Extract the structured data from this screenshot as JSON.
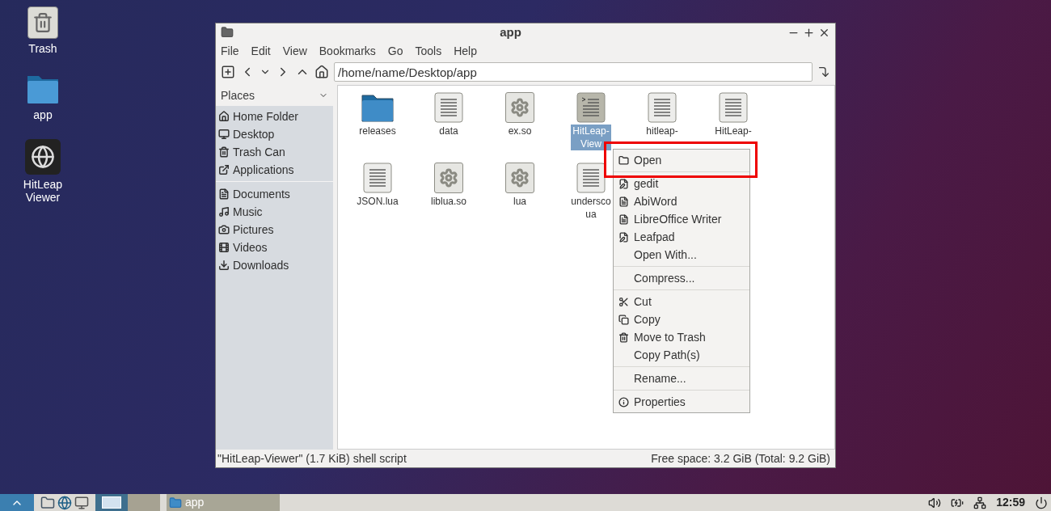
{
  "desktop_icons": [
    {
      "kind": "trash",
      "lines": [
        "Trash"
      ]
    },
    {
      "kind": "folder",
      "lines": [
        "app"
      ]
    },
    {
      "kind": "globe",
      "lines": [
        "HitLeap",
        "Viewer"
      ]
    }
  ],
  "window": {
    "title": "app",
    "menu": [
      "File",
      "Edit",
      "View",
      "Bookmarks",
      "Go",
      "Tools",
      "Help"
    ],
    "path": "/home/name/Desktop/app",
    "sidebar": {
      "header": "Places",
      "groups": [
        [
          "Home Folder",
          "Desktop",
          "Trash Can",
          "Applications"
        ],
        [
          "Documents",
          "Music",
          "Pictures",
          "Videos",
          "Downloads"
        ]
      ]
    },
    "files": [
      {
        "kind": "folder",
        "lines": [
          "releases"
        ],
        "selected": false
      },
      {
        "kind": "text",
        "lines": [
          "data"
        ],
        "selected": false
      },
      {
        "kind": "library",
        "lines": [
          "ex.so"
        ],
        "selected": false
      },
      {
        "kind": "script",
        "lines": [
          "HitLeap-",
          "View"
        ],
        "selected": true
      },
      {
        "kind": "text",
        "lines": [
          "hitleap-"
        ],
        "selected": false
      },
      {
        "kind": "text",
        "lines": [
          "HitLeap-"
        ],
        "selected": false
      },
      {
        "kind": "text",
        "lines": [
          "JSON.lua"
        ],
        "selected": false
      },
      {
        "kind": "library",
        "lines": [
          "liblua.so"
        ],
        "selected": false
      },
      {
        "kind": "library",
        "lines": [
          "lua"
        ],
        "selected": false
      },
      {
        "kind": "text",
        "lines": [
          "undersco",
          "ua"
        ],
        "selected": false
      }
    ],
    "status_left": "\"HitLeap-Viewer\" (1.7 KiB) shell script",
    "status_right": "Free space: 3.2 GiB (Total: 9.2 GiB)"
  },
  "context_menu": [
    {
      "kind": "item",
      "label": "Open"
    },
    {
      "kind": "separator"
    },
    {
      "kind": "item",
      "label": "gedit"
    },
    {
      "kind": "item",
      "label": "AbiWord"
    },
    {
      "kind": "item",
      "label": "LibreOffice Writer"
    },
    {
      "kind": "item",
      "label": "Leafpad"
    },
    {
      "kind": "item",
      "label": "Open With..."
    },
    {
      "kind": "separator"
    },
    {
      "kind": "item",
      "label": "Compress..."
    },
    {
      "kind": "separator"
    },
    {
      "kind": "item",
      "label": "Cut"
    },
    {
      "kind": "item",
      "label": "Copy"
    },
    {
      "kind": "item",
      "label": "Move to Trash"
    },
    {
      "kind": "item",
      "label": "Copy Path(s)"
    },
    {
      "kind": "separator"
    },
    {
      "kind": "item",
      "label": "Rename..."
    },
    {
      "kind": "separator"
    },
    {
      "kind": "item",
      "label": "Properties"
    }
  ],
  "taskbar": {
    "workspaces": [
      {
        "selected": true
      },
      {
        "selected": false
      }
    ],
    "task": "app",
    "clock": "12:59"
  }
}
